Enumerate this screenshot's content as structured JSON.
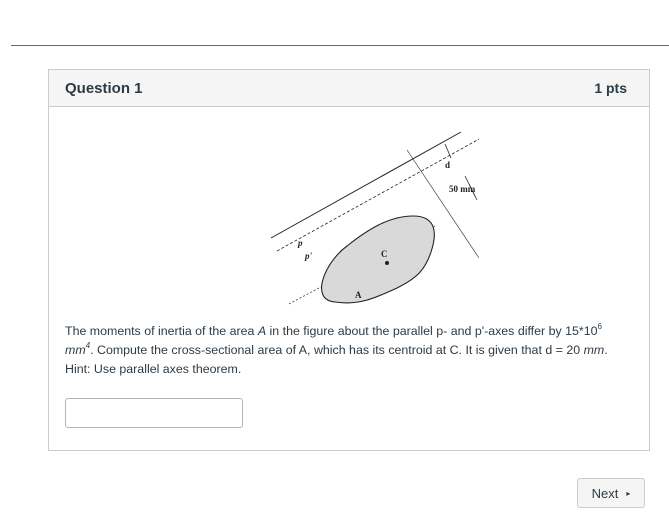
{
  "question": {
    "title": "Question 1",
    "points": "1 pts",
    "figure_labels": {
      "d": "d",
      "dim": "50 mm",
      "p": "p",
      "p_prime": "p'",
      "c": "C",
      "a": "A"
    },
    "text": {
      "part1": "The moments of inertia of the area ",
      "area_var": "A",
      "part2": " in the figure about the parallel p- and p'-axes differ by 15*10",
      "exp6": "6",
      "unit_mm": "mm",
      "exp4": "4",
      "part3": ". Compute the cross-sectional area of A, which has its centroid at C. It is given that d = 20 ",
      "unit_mm2": "mm",
      "part4": ".",
      "hint": "Hint: Use parallel axes theorem."
    },
    "answer_value": ""
  },
  "nav": {
    "next_label": "Next",
    "next_arrow": "▸"
  }
}
